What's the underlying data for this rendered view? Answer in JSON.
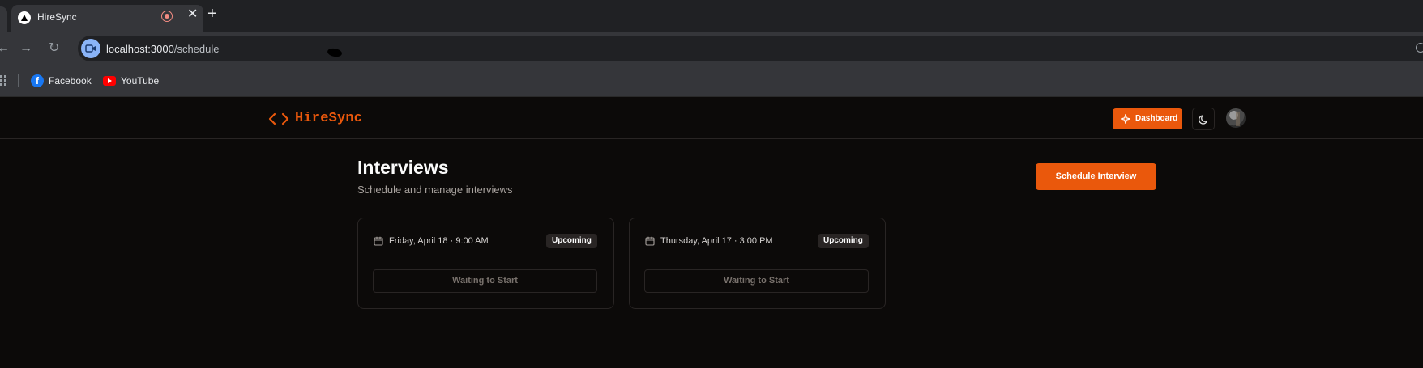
{
  "browser": {
    "tab_title": "HireSync",
    "new_tab_symbol": "+",
    "close_symbol": "✕",
    "url_host": "localhost:3000",
    "url_path": "/schedule",
    "bookmarks": [
      {
        "label": "Facebook",
        "icon": "facebook-icon"
      },
      {
        "label": "YouTube",
        "icon": "youtube-icon"
      }
    ]
  },
  "app": {
    "brand": "HireSync",
    "nav": {
      "dashboard_label": "Dashboard"
    },
    "page": {
      "title": "Interviews",
      "subtitle": "Schedule and manage interviews",
      "schedule_button": "Schedule Interview"
    },
    "interviews": [
      {
        "date": "Friday, April 18 · 9:00 AM",
        "status": "Upcoming",
        "action": "Waiting to Start"
      },
      {
        "date": "Thursday, April 17 · 3:00 PM",
        "status": "Upcoming",
        "action": "Waiting to Start"
      }
    ]
  },
  "colors": {
    "accent": "#ea580c",
    "background": "#0c0a09",
    "border": "#292524"
  }
}
